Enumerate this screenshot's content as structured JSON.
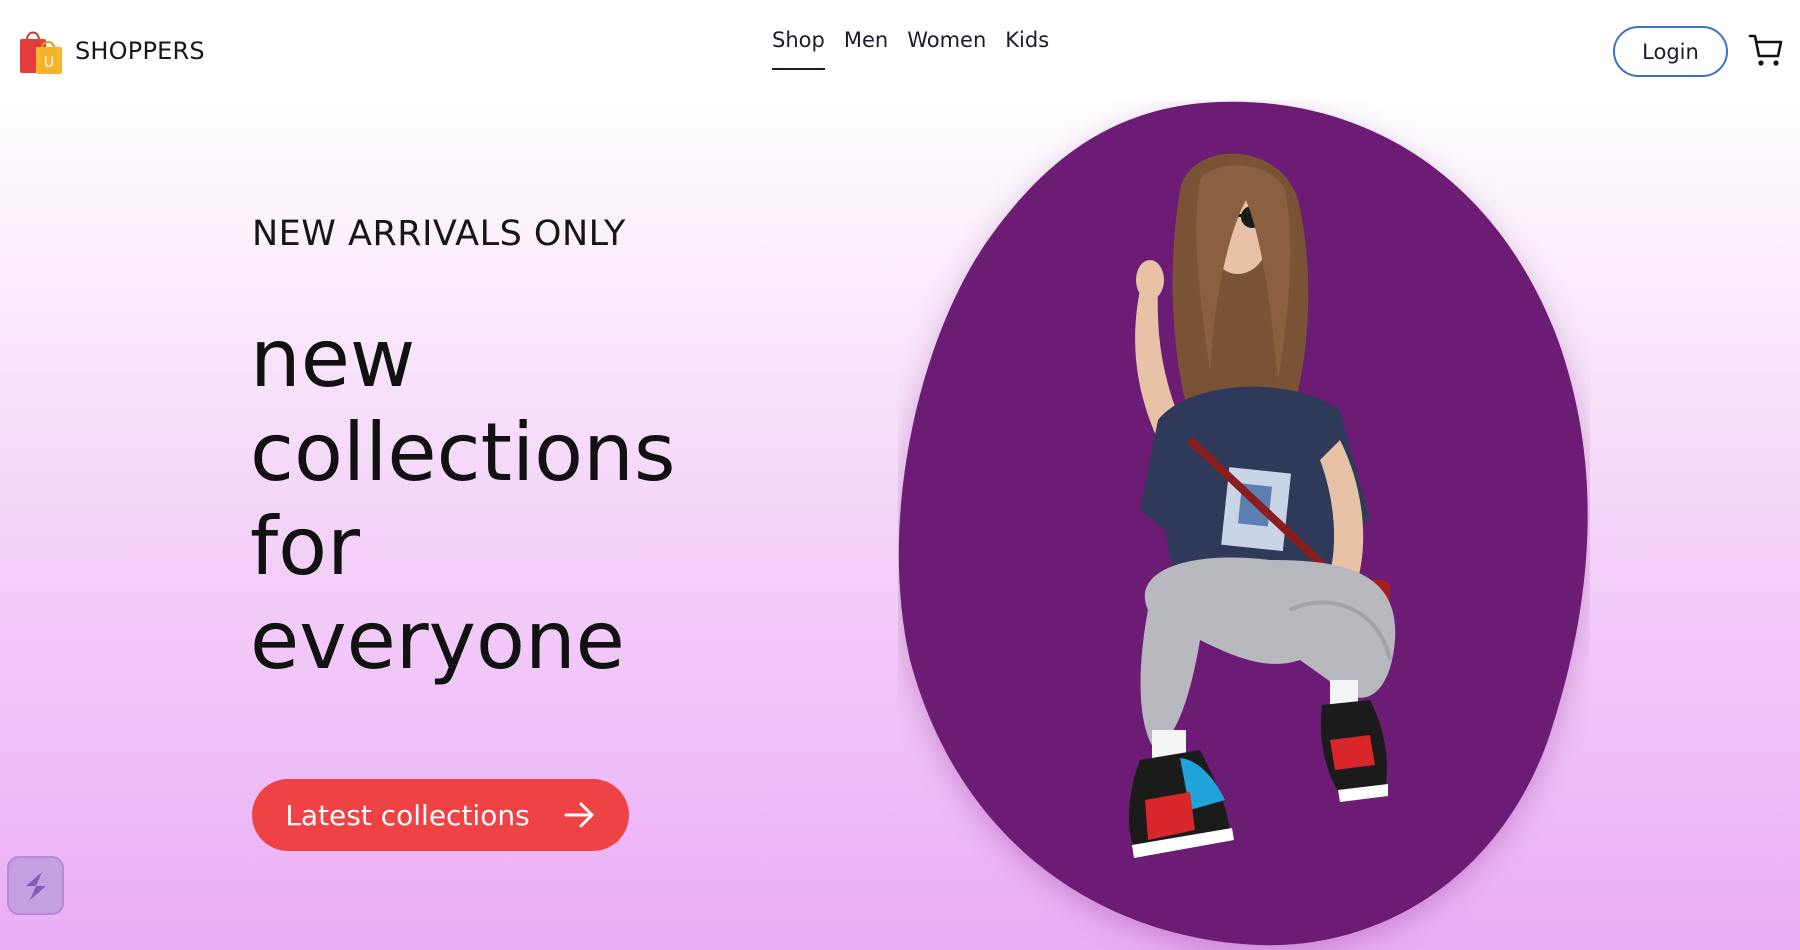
{
  "header": {
    "brand_name": "SHOPPERS",
    "nav": [
      {
        "label": "Shop",
        "active": true
      },
      {
        "label": "Men",
        "active": false
      },
      {
        "label": "Women",
        "active": false
      },
      {
        "label": "Kids",
        "active": false
      }
    ],
    "login_label": "Login"
  },
  "hero": {
    "eyebrow": "NEW ARRIVALS ONLY",
    "title_lines": [
      "new",
      "collections",
      "for",
      "everyone"
    ],
    "cta_label": "Latest collections"
  },
  "icons": {
    "logo": "shopping-bags-icon",
    "cart": "cart-icon",
    "cta_arrow": "arrow-right-icon",
    "widget": "assistant-widget-icon"
  },
  "colors": {
    "accent": "#ef4245",
    "blob": "#6d1a74",
    "login_border": "#3b6fd6",
    "gradient_bottom": "#ebadf7"
  }
}
